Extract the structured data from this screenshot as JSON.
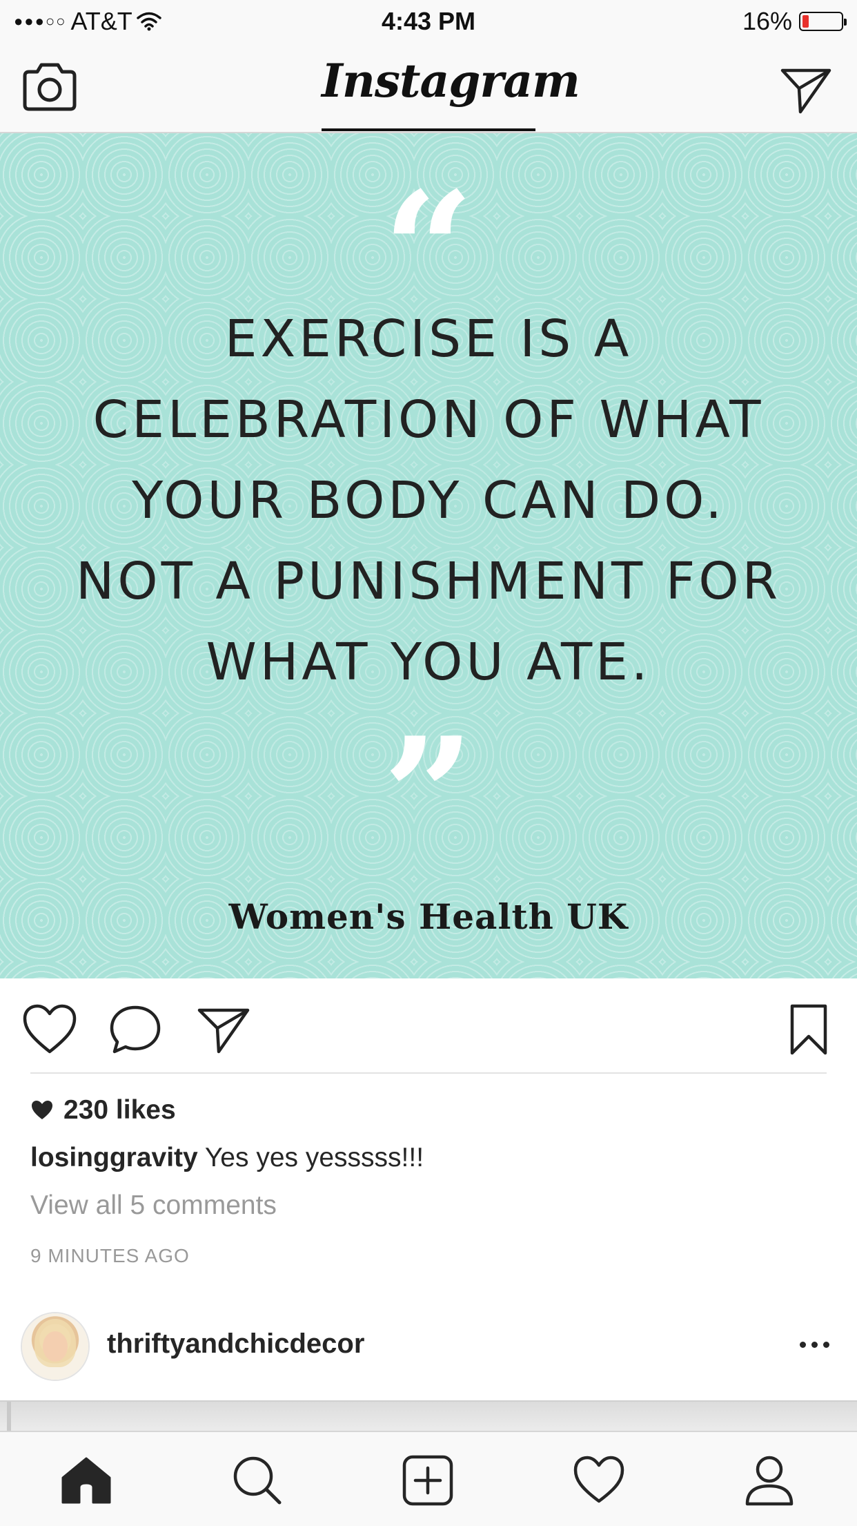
{
  "status_bar": {
    "signal": "●●●○○",
    "carrier": "AT&T",
    "time": "4:43 PM",
    "battery_percent": "16%",
    "battery_level": 0.16,
    "battery_color": "#e8302b"
  },
  "header": {
    "logo": "Instagram",
    "left_icon": "camera-icon",
    "right_icon": "direct-message-icon"
  },
  "post": {
    "image": {
      "background_color": "#a9e2d8",
      "quote_open": "“",
      "quote_lines": [
        "EXERCISE IS A",
        "CELEBRATION OF WHAT",
        "YOUR BODY CAN DO.",
        "NOT A PUNISHMENT FOR",
        "WHAT YOU ATE."
      ],
      "quote_close": "”",
      "credit": "Women's Health UK"
    },
    "actions": {
      "icons": [
        "heart-icon",
        "comment-icon",
        "share-icon",
        "bookmark-icon"
      ]
    },
    "likes": "230 likes",
    "caption": {
      "username": "losinggravity",
      "text": "Yes yes yesssss!!!"
    },
    "view_comments": "View all 5 comments",
    "timestamp": "9 MINUTES AGO"
  },
  "next_post": {
    "username": "thriftyandchicdecor",
    "more_icon": "more-options-icon"
  },
  "tab_bar": {
    "tabs": [
      "home-icon",
      "search-icon",
      "add-post-icon",
      "activity-heart-icon",
      "profile-icon"
    ],
    "active": "home"
  }
}
